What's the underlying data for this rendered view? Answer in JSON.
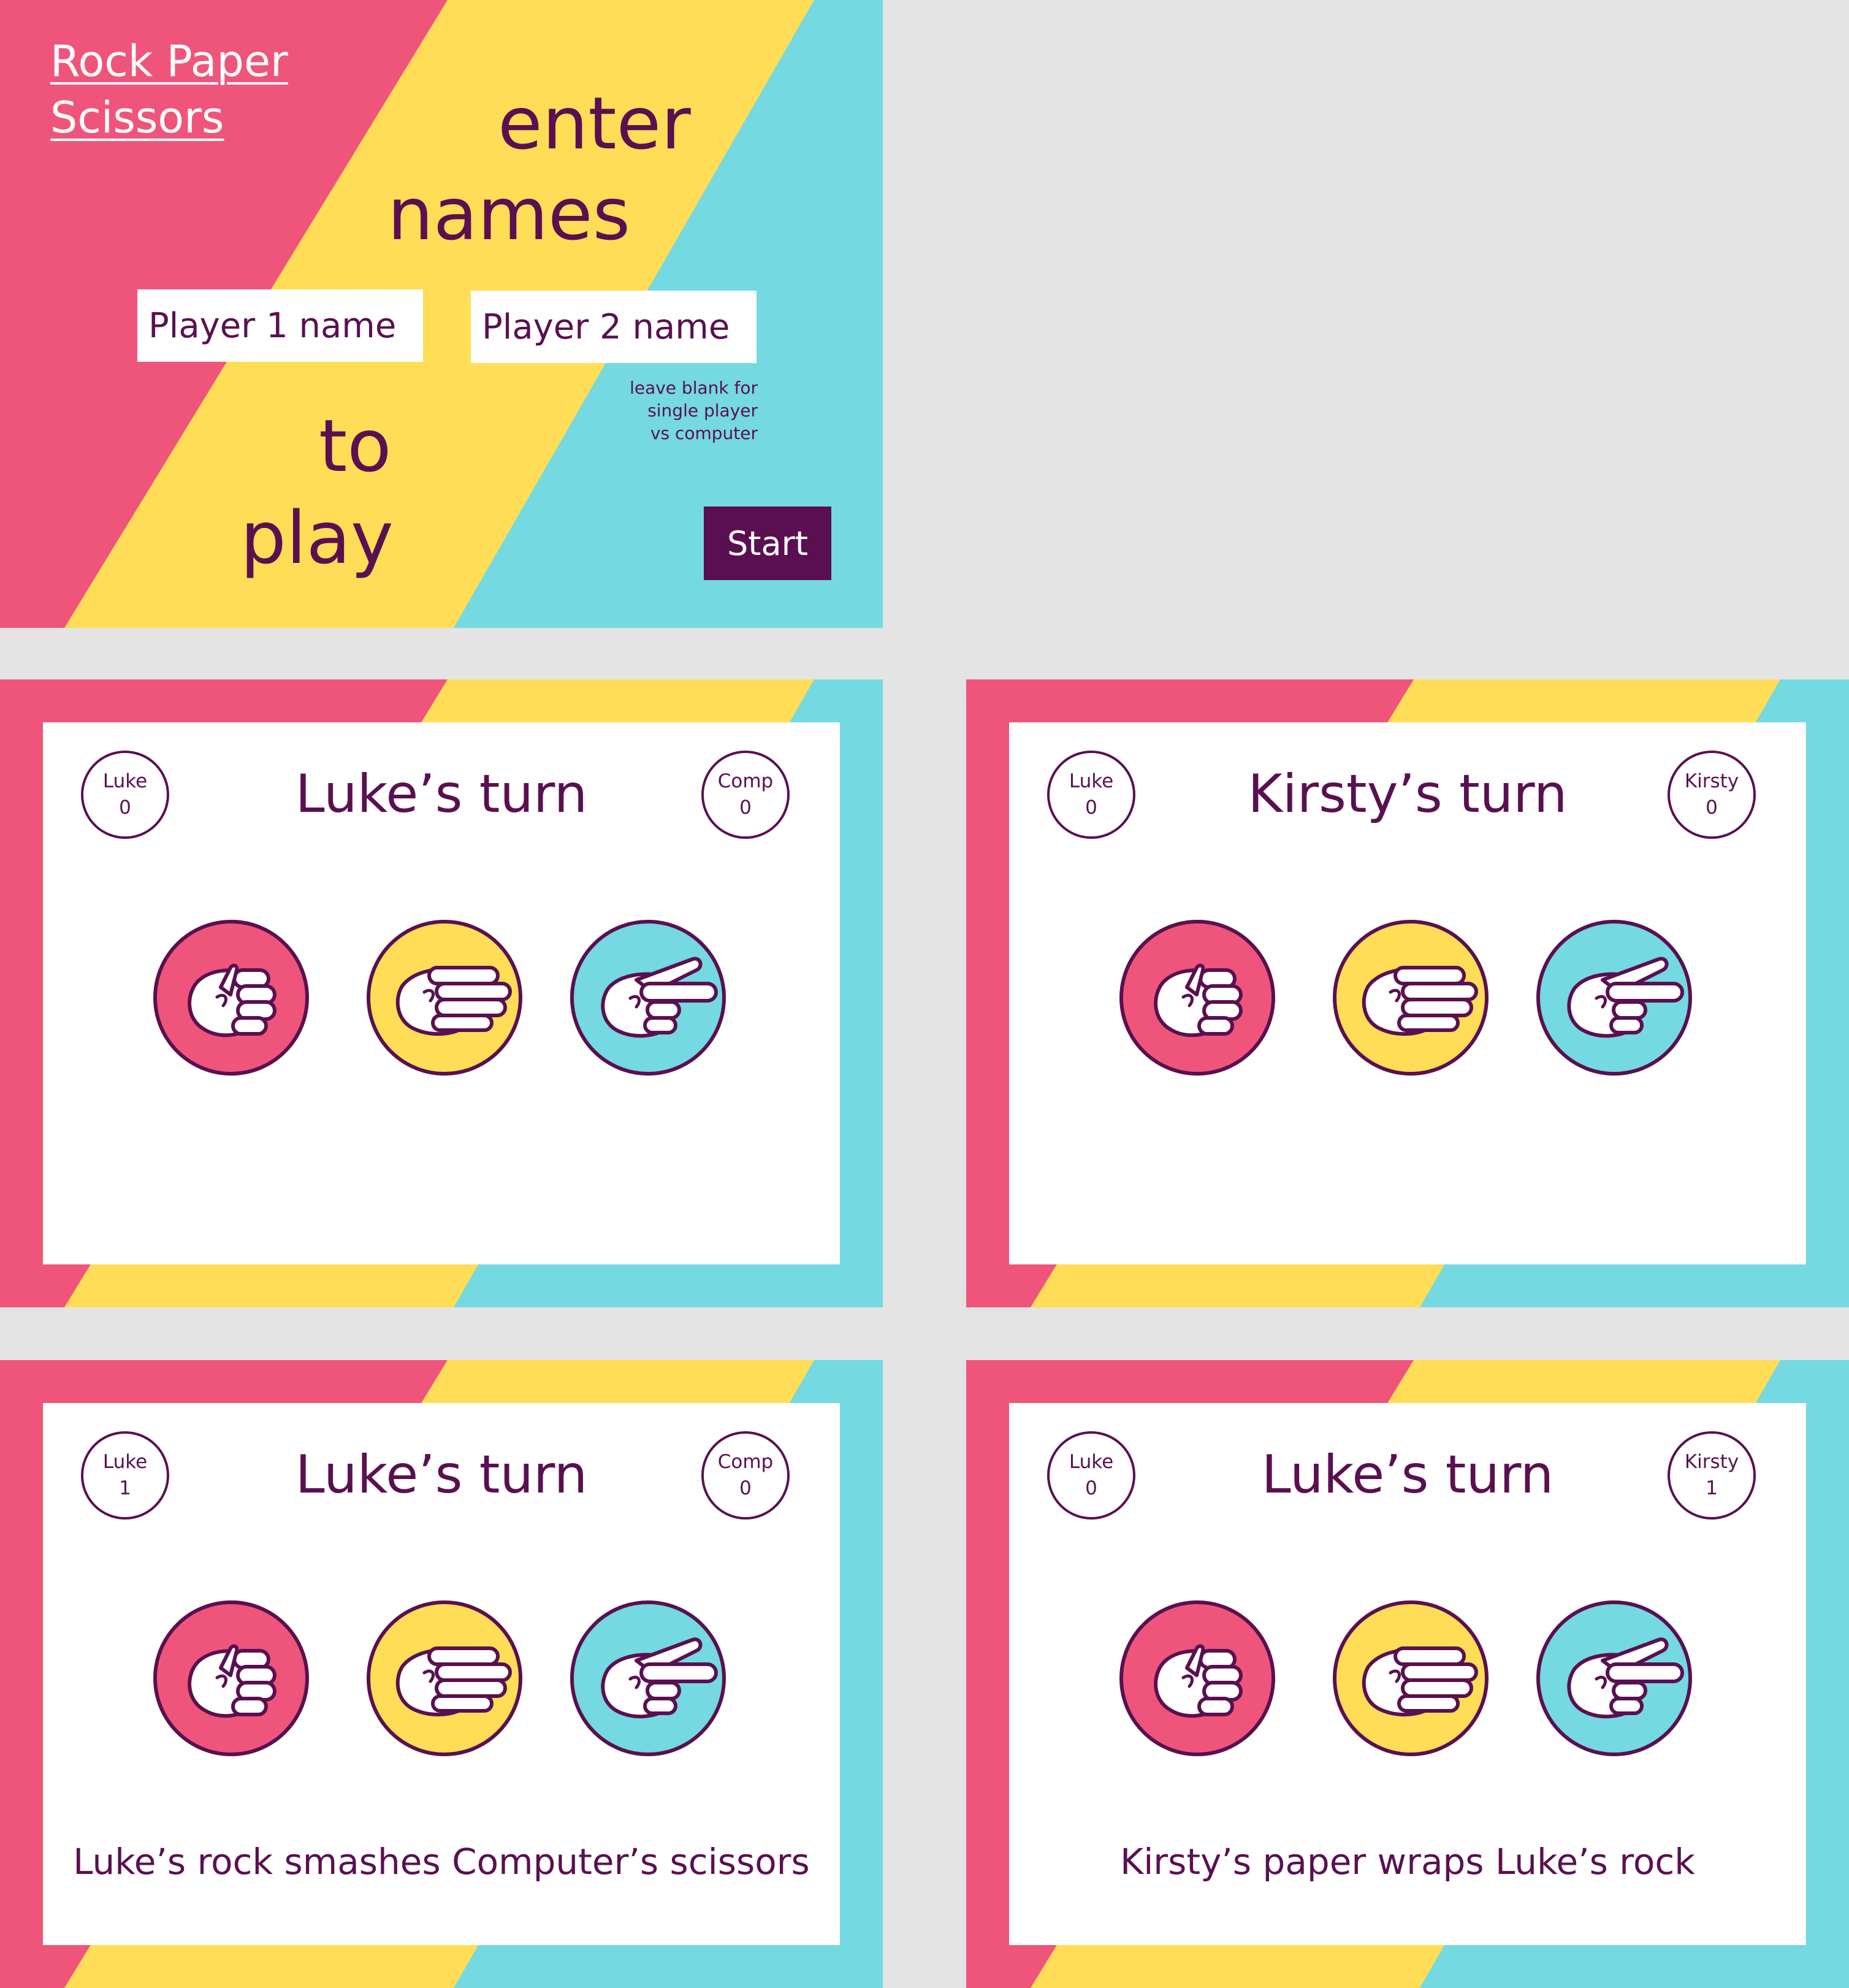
{
  "start_screen": {
    "logo": "Rock Paper\nScissors",
    "heading": [
      "enter",
      "names",
      "to",
      "play"
    ],
    "player1": {
      "placeholder": "Player 1 name",
      "value": ""
    },
    "player2": {
      "placeholder": "Player 2 name",
      "value": ""
    },
    "hint": "leave blank for\nsingle player\nvs computer",
    "start_label": "Start"
  },
  "colors": {
    "pink": "#ef557b",
    "yellow": "#ffdd57",
    "cyan": "#74d9e0",
    "purple": "#5a1050",
    "backdrop": "#e4e4e4"
  },
  "icons": [
    "rock-hand-icon",
    "paper-hand-icon",
    "scissors-hand-icon"
  ],
  "game_screens": [
    {
      "left": {
        "name": "Luke",
        "score": "0"
      },
      "right": {
        "name": "Comp",
        "score": "0"
      },
      "title": "Luke’s turn",
      "message": ""
    },
    {
      "left": {
        "name": "Luke",
        "score": "0"
      },
      "right": {
        "name": "Kirsty",
        "score": "0"
      },
      "title": "Kirsty’s turn",
      "message": ""
    },
    {
      "left": {
        "name": "Luke",
        "score": "1"
      },
      "right": {
        "name": "Comp",
        "score": "0"
      },
      "title": "Luke’s turn",
      "message": "Luke’s rock smashes Computer’s scissors"
    },
    {
      "left": {
        "name": "Luke",
        "score": "0"
      },
      "right": {
        "name": "Kirsty",
        "score": "1"
      },
      "title": "Luke’s turn",
      "message": "Kirsty’s paper wraps Luke’s rock"
    }
  ]
}
